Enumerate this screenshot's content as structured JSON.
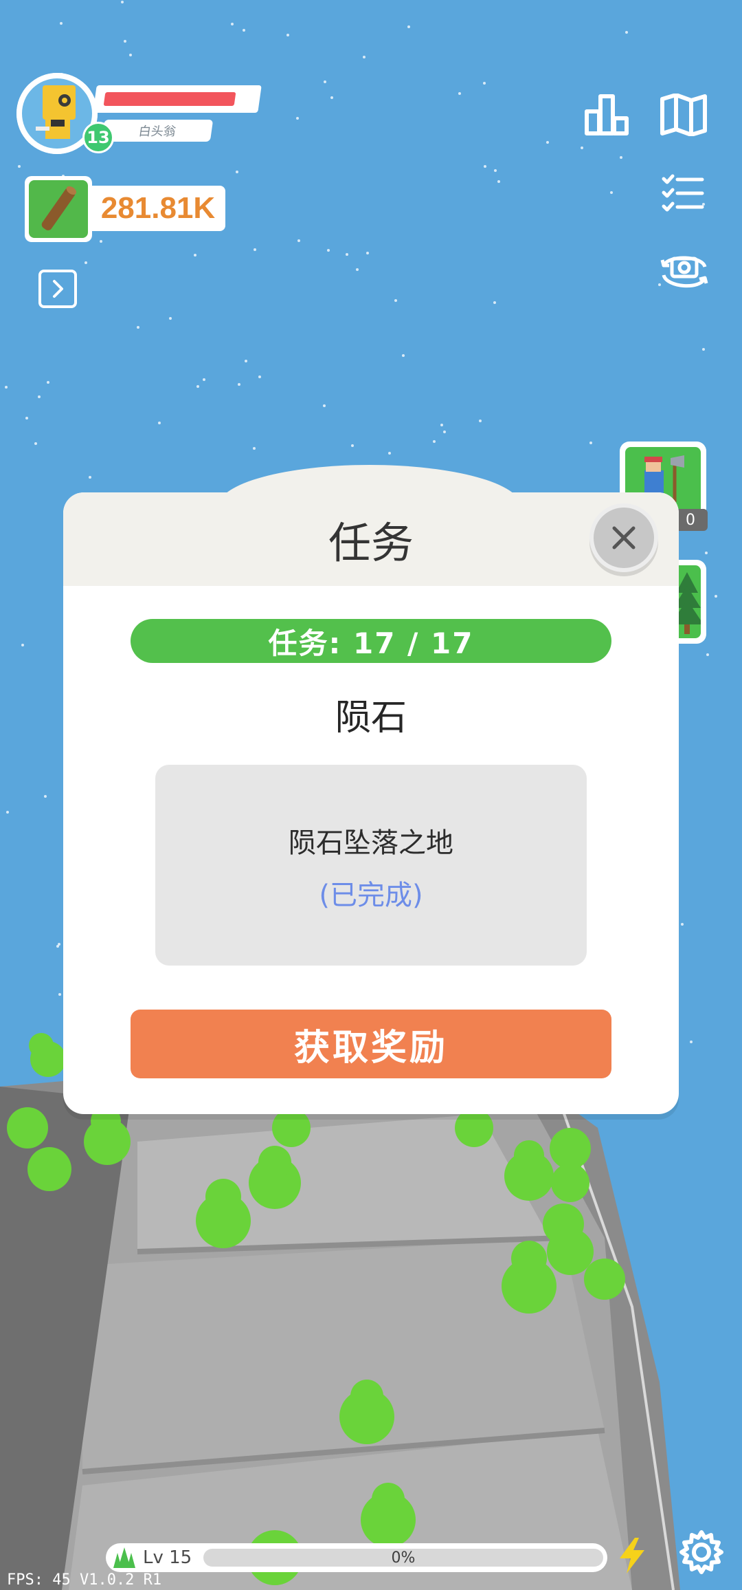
{
  "hud": {
    "player_level": "13",
    "player_name": "白头翁",
    "hp_fraction": 0.92,
    "wood_amount": "281.81K"
  },
  "side_cards": {
    "worker_count_partial": "0"
  },
  "dialog": {
    "title": "任务",
    "progress_label": "任务: 17 / 17",
    "task_name": "陨石",
    "task_description": "陨石坠落之地",
    "task_status": "(已完成)",
    "reward_button_label": "获取奖励"
  },
  "bottom": {
    "level_label": "Lv 15",
    "xp_percent_label": "0%",
    "xp_fraction": 0.0,
    "fps_label": "FPS: 45   V1.0.2  R1"
  },
  "colors": {
    "sky": "#5aa6dc",
    "accent_green": "#53c04c",
    "accent_orange": "#f18150",
    "status_blue": "#6d8de8",
    "hp_red": "#f2555c",
    "wood_orange": "#e88a32"
  },
  "icons": {
    "stats": "bar-chart-icon",
    "map": "map-icon",
    "tasks": "checklist-icon",
    "camera": "camera-rotate-icon",
    "expand": "chevron-right-icon",
    "close": "close-icon",
    "energy": "lightning-icon",
    "settings": "gear-icon",
    "tree": "tree-icon",
    "wood": "wood-log-icon"
  }
}
